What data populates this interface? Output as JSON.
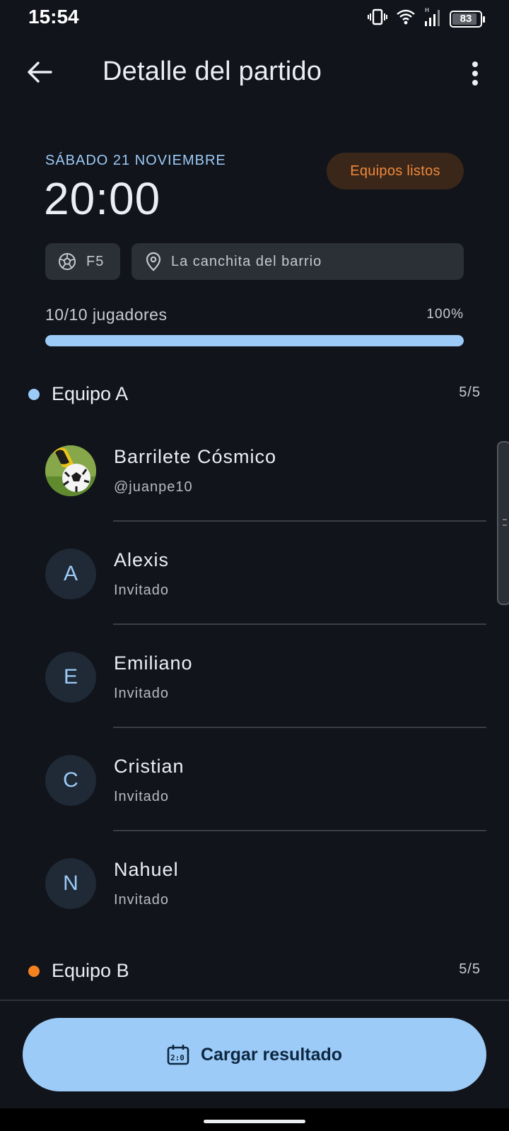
{
  "status_bar": {
    "time": "15:54",
    "battery": "83",
    "icons": [
      "vibrate-icon",
      "wifi-icon",
      "signal-icon",
      "battery-icon"
    ]
  },
  "app_bar": {
    "title": "Detalle del partido",
    "back_icon": "arrow-back-icon",
    "menu_icon": "more-vert-icon"
  },
  "match": {
    "date": "SÁBADO 21 NOVIEMBRE",
    "time": "20:00",
    "status": "Equipos listos",
    "format": "F5",
    "location": "La canchita del barrio",
    "players_count": "10/10 jugadores",
    "players_percent": "100%",
    "fill_fraction": 1.0
  },
  "teams": [
    {
      "name": "Equipo A",
      "count": "5/5",
      "color": "#9ccbf8",
      "players": [
        {
          "name": "Barrilete Cósmico",
          "sub": "@juanpe10",
          "initial": "",
          "photo": true
        },
        {
          "name": "Alexis",
          "sub": "Invitado",
          "initial": "A"
        },
        {
          "name": "Emiliano",
          "sub": "Invitado",
          "initial": "E"
        },
        {
          "name": "Cristian",
          "sub": "Invitado",
          "initial": "C"
        },
        {
          "name": "Nahuel",
          "sub": "Invitado",
          "initial": "N"
        }
      ]
    },
    {
      "name": "Equipo B",
      "count": "5/5",
      "color": "#f58220"
    }
  ],
  "cta": {
    "label": "Cargar resultado",
    "icon": "scoreboard-icon"
  },
  "colors": {
    "background": "#11141a",
    "accent": "#9ccbf8",
    "status_orange": "#f0883a"
  }
}
